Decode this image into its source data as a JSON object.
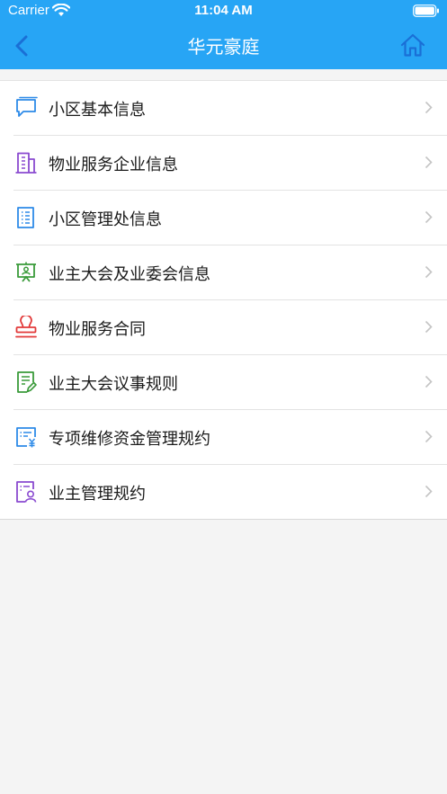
{
  "status_bar": {
    "carrier": "Carrier",
    "time": "11:04 AM"
  },
  "nav": {
    "title": "华元豪庭"
  },
  "menu": {
    "items": [
      {
        "label": "小区基本信息",
        "icon": "chat-icon",
        "color": "#2d8ae8"
      },
      {
        "label": "物业服务企业信息",
        "icon": "building-icon",
        "color": "#8a4ad0"
      },
      {
        "label": "小区管理处信息",
        "icon": "list-document-icon",
        "color": "#2d8ae8"
      },
      {
        "label": "业主大会及业委会信息",
        "icon": "presentation-board-icon",
        "color": "#3a9b3a"
      },
      {
        "label": "物业服务合同",
        "icon": "stamp-icon",
        "color": "#e23a3a"
      },
      {
        "label": "业主大会议事规则",
        "icon": "document-edit-icon",
        "color": "#3a9b3a"
      },
      {
        "label": "专项维修资金管理规约",
        "icon": "fund-document-icon",
        "color": "#2d8ae8"
      },
      {
        "label": "业主管理规约",
        "icon": "user-document-icon",
        "color": "#8a4ad0"
      }
    ]
  },
  "colors": {
    "header": "#27a5f5",
    "background": "#f4f4f4"
  }
}
